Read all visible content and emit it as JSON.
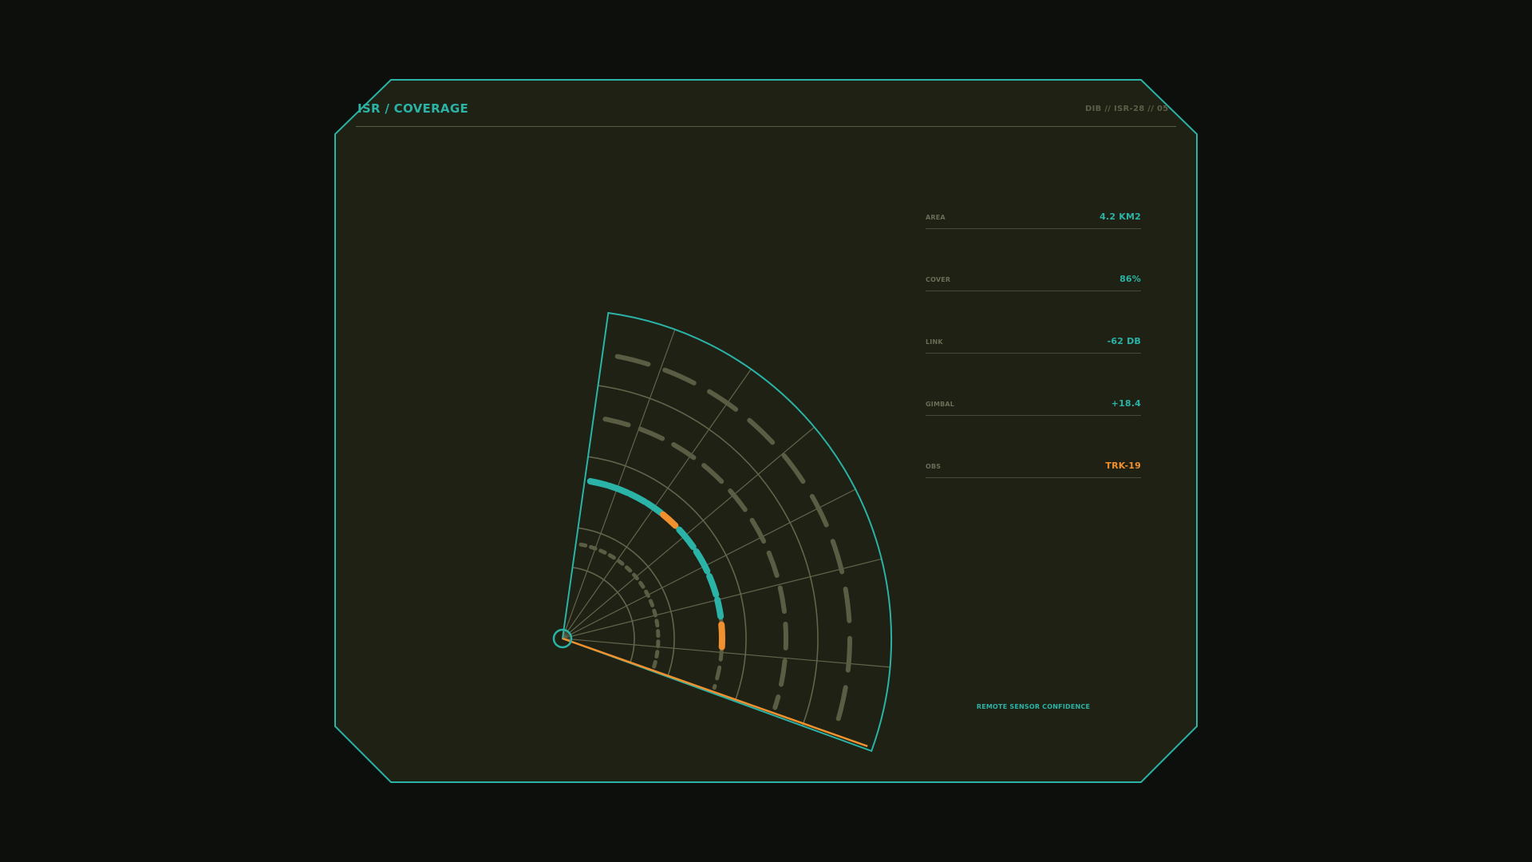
{
  "header": {
    "title": "ISR / COVERAGE",
    "id": "DIB // ISR-28 // 05"
  },
  "colors": {
    "background": "#0d0f0c",
    "panel": "#1e2113",
    "accent": "#2ab3a6",
    "warning": "#f0902e",
    "grid": "#62654c",
    "muted_arc": "#5a5d43"
  },
  "stats": [
    {
      "label": "AREA",
      "value": "4.2 KM2",
      "status": "normal"
    },
    {
      "label": "COVER",
      "value": "86%",
      "status": "normal"
    },
    {
      "label": "LINK",
      "value": "-62 DB",
      "status": "normal"
    },
    {
      "label": "GIMBAL",
      "value": "+18.4",
      "status": "normal"
    },
    {
      "label": "OBS",
      "value": "TRK-19",
      "status": "warning"
    }
  ],
  "footer": {
    "label": "REMOTE SENSOR CONFIDENCE"
  }
}
